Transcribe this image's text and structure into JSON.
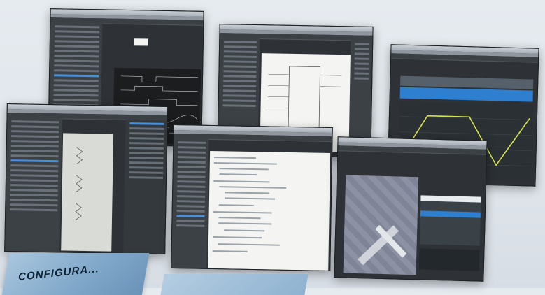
{
  "caption": {
    "label": "CONFIGURA..."
  },
  "colors": {
    "background": "#e1e6ec",
    "app_chrome": "#2e3236",
    "tree_highlight": "#4b8fd9",
    "chart_yellow": "#d8e24a",
    "waveform_green": "#7fd26a",
    "table_blue": "#2f7fd0",
    "caption_slab": "#7ea6c8"
  },
  "screens": [
    {
      "name": "timing-chart-editor",
      "content": "dark-waveform"
    },
    {
      "name": "function-block-editor",
      "content": "white-block-diagram"
    },
    {
      "name": "data-trace",
      "content": "trapezoid-trace"
    },
    {
      "name": "ladder-editor",
      "content": "ladder-rungs"
    },
    {
      "name": "structured-text-editor",
      "content": "code-listing"
    },
    {
      "name": "3d-motion-simulation",
      "content": "3d-view-with-table"
    }
  ]
}
